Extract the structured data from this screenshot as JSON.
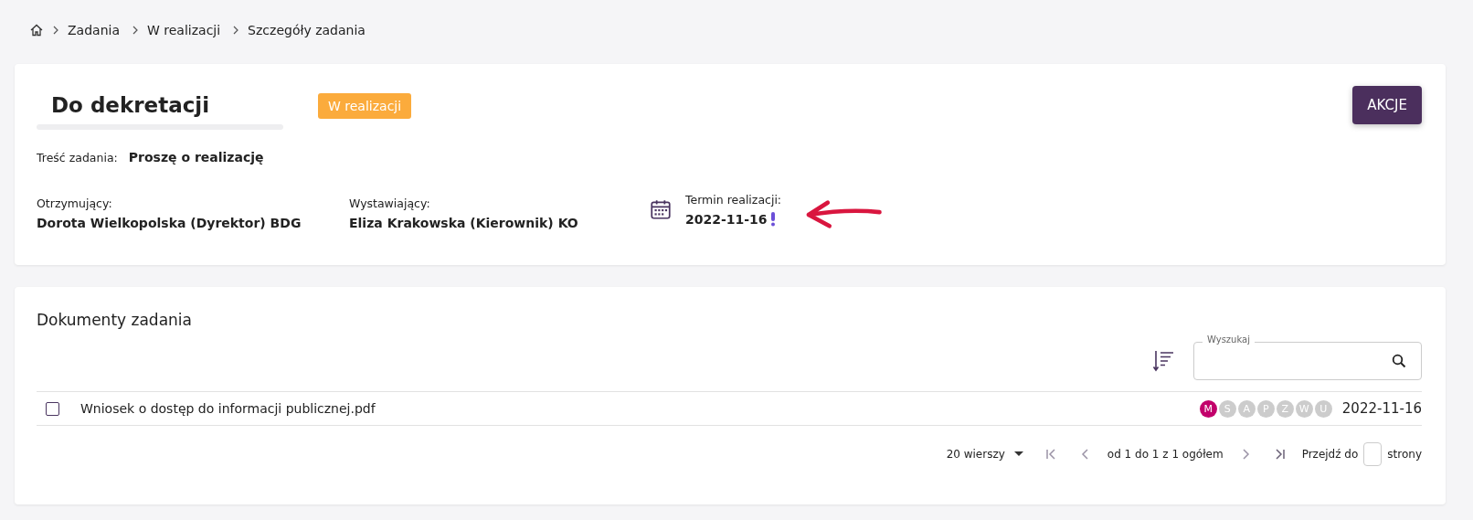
{
  "breadcrumb": [
    "Zadania",
    "W realizacji",
    "Szczegóły zadania"
  ],
  "task": {
    "title": "Do dekretacji",
    "status": "W realizacji",
    "action_button": "AKCJE",
    "content_label": "Treść zadania:",
    "content_value": "Proszę o realizację",
    "fields": [
      {
        "label": "Otrzymujący:",
        "value": "Dorota Wielkopolska (Dyrektor) BDG"
      },
      {
        "label": "Wystawiający:",
        "value": "Eliza Krakowska (Kierownik) KO"
      }
    ],
    "deadline": {
      "label": "Termin realizacji:",
      "value": "2022-11-16",
      "warning": true
    }
  },
  "documents": {
    "title": "Dokumenty zadania",
    "search": {
      "label": "Wyszukaj"
    },
    "rows": [
      {
        "name": "Wniosek o dostęp do informacji publicznej.pdf",
        "checked": false,
        "date": "2022-11-16",
        "badges": [
          {
            "letter": "M",
            "color": "#c2006b"
          },
          {
            "letter": "S",
            "color": "#cccccc"
          },
          {
            "letter": "A",
            "color": "#cccccc"
          },
          {
            "letter": "P",
            "color": "#cccccc"
          },
          {
            "letter": "Z",
            "color": "#cccccc"
          },
          {
            "letter": "W",
            "color": "#cccccc"
          },
          {
            "letter": "U",
            "color": "#cccccc"
          }
        ]
      }
    ],
    "pagination": {
      "rows_per_page": "20 wierszy",
      "range": "od 1 do 1 z 1 ogółem",
      "goto_label": "Przejdź do",
      "goto_suffix": "strony"
    }
  }
}
